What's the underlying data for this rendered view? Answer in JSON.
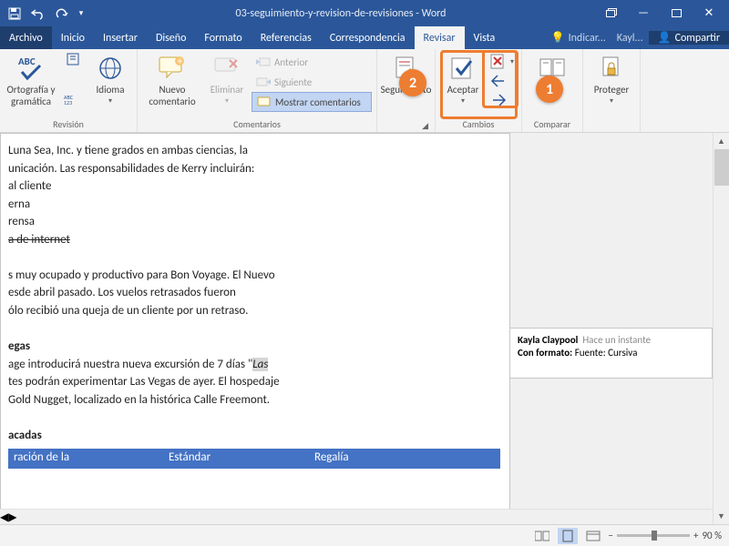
{
  "title": "03-seguimiento-y-revision-de-revisiones  -  Word",
  "qat": {
    "save": "save-icon",
    "undo": "undo-icon",
    "redo": "redo-icon"
  },
  "tabs": [
    "Archivo",
    "Inicio",
    "Insertar",
    "Diseño",
    "Formato",
    "Referencias",
    "Correspondencia",
    "Revisar",
    "Vista"
  ],
  "active_tab": 7,
  "tell_me": "Indicar...",
  "user": "Kayl...",
  "share": "Compartir",
  "ribbon": {
    "revision": {
      "label": "Revisión",
      "ortografia": "Ortografía y gramática",
      "idioma": "Idioma"
    },
    "comentarios": {
      "label": "Comentarios",
      "nuevo": "Nuevo comentario",
      "eliminar": "Eliminar",
      "anterior": "Anterior",
      "siguiente": "Siguiente",
      "mostrar": "Mostrar comentarios"
    },
    "seguimiento": {
      "label": "",
      "btn": "Seguimiento"
    },
    "cambios": {
      "label": "Cambios",
      "aceptar": "Aceptar",
      "rechazar": "",
      "anterior": "",
      "siguiente": ""
    },
    "comparar": {
      "label": "Comparar",
      "btn": "ar"
    },
    "proteger": {
      "label": "",
      "btn": "Proteger"
    }
  },
  "callouts": {
    "one": "1",
    "two": "2"
  },
  "doc": {
    "l1": "Luna Sea, Inc. y tiene grados en ambas ciencias, la",
    "l2": "unicación. Las responsabilidades de Kerry incluirán:",
    "l3": "al cliente",
    "l4": "erna",
    "l5": "rensa",
    "l6": "a de internet",
    "l7": "s muy ocupado y productivo para Bon Voyage. El Nuevo",
    "l8": "esde abril pasado. Los vuelos retrasados fueron",
    "l9": "ólo recibió una queja de un cliente por un retraso.",
    "h1": "egas",
    "l10a": "age introducirá nuestra nueva excursión de 7 días \"",
    "l10b": "Las",
    "l11": "tes podrán experimentar Las Vegas de ayer. El hospedaje",
    "l12": "Gold Nugget, localizado en la histórica Calle Freemont.",
    "h2": "acadas",
    "thdr": [
      "ración de la",
      "Estándar",
      "Regalía"
    ]
  },
  "revpane": {
    "author": "Kayla Claypool",
    "time": "Hace un instante",
    "label": "Con formato:",
    "value": "Fuente: Cursiva"
  },
  "status": {
    "zoom": "90 %"
  }
}
